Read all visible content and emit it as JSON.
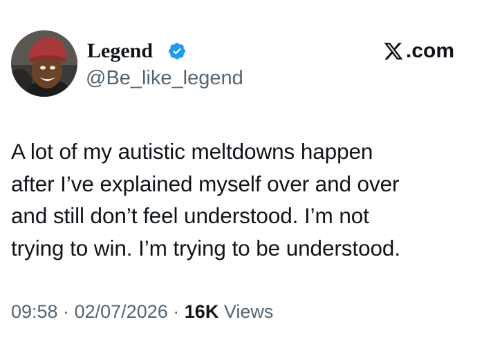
{
  "tweet": {
    "author": {
      "name": "Legend",
      "handle": "@Be_like_legend",
      "verified": true,
      "avatar_icon": "profile-photo"
    },
    "brand": {
      "domain": ".com",
      "logo_icon": "x-logo-icon"
    },
    "text_lines": [
      "A lot of my autistic meltdowns happen",
      "after I’ve explained myself over and over",
      "and still don’t feel understood. I’m not",
      "trying to win. I’m trying to be understood."
    ],
    "meta": {
      "time": "09:58",
      "separator": "·",
      "date": "02/07/2026",
      "views_count": "16K",
      "views_label": "Views"
    }
  },
  "colors": {
    "text_primary": "#0f1419",
    "text_secondary": "#536471",
    "verified_blue": "#1d9bf0",
    "background": "#ffffff"
  }
}
